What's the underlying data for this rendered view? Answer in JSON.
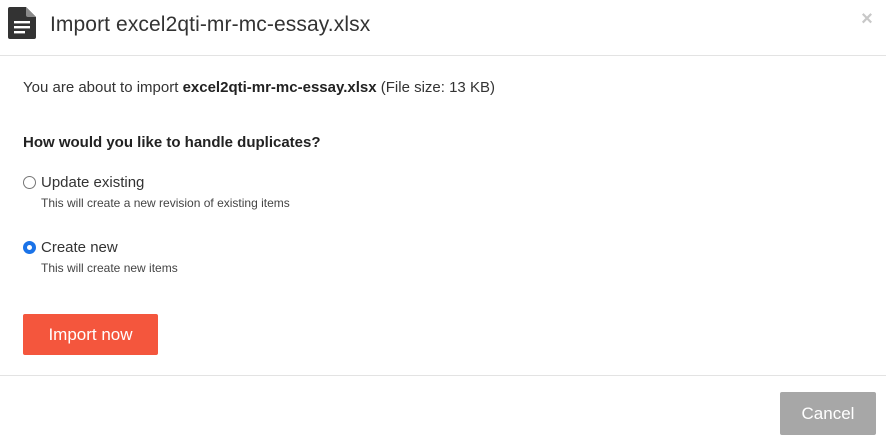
{
  "dialog": {
    "title": "Import excel2qti-mr-mc-essay.xlsx",
    "close_glyph": "×",
    "header_icon": "document-icon"
  },
  "intro": {
    "prefix": "You are about to import ",
    "filename": "excel2qti-mr-mc-essay.xlsx",
    "suffix": " (File size: 13 KB)"
  },
  "duplicates": {
    "question": "How would you like to handle duplicates?",
    "selected": "create_new",
    "options": [
      {
        "id": "update_existing",
        "label": "Update existing",
        "help": "This will create a new revision of existing items"
      },
      {
        "id": "create_new",
        "label": "Create new",
        "help": "This will create new items"
      }
    ]
  },
  "actions": {
    "import_label": "Import now",
    "cancel_label": "Cancel"
  },
  "colors": {
    "primary": "#f4563d",
    "secondary": "#a7a7a7",
    "radio_selected": "#1a73e8"
  }
}
